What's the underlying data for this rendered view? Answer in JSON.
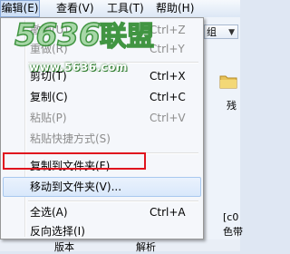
{
  "menubar": {
    "items": [
      {
        "label": "编辑(E)",
        "active": true
      },
      {
        "label": "查看(V)"
      },
      {
        "label": "工具(T)"
      },
      {
        "label": "帮助(H)"
      }
    ]
  },
  "background": {
    "combo_label": "组",
    "partial_text_1": "残",
    "partial_text_2": "[c0",
    "partial_text_3": "色带",
    "partial_text_4": "版本",
    "partial_text_5": "解析"
  },
  "menu": {
    "items": [
      {
        "label": "撤销(U)",
        "shortcut": "Ctrl+Z"
      },
      {
        "label": "重做(R)",
        "shortcut": "Ctrl+Y"
      },
      {
        "label": "剪切(T)",
        "shortcut": "Ctrl+X"
      },
      {
        "label": "复制(C)",
        "shortcut": "Ctrl+C"
      },
      {
        "label": "粘贴(P)",
        "shortcut": "Ctrl+V",
        "disabled": true
      },
      {
        "label": "粘贴快捷方式(S)",
        "disabled": true
      },
      {
        "label": "复制到文件夹(F)..."
      },
      {
        "label": "移动到文件夹(V)..."
      },
      {
        "label": "全选(A)",
        "shortcut": "Ctrl+A"
      },
      {
        "label": "反向选择(I)"
      }
    ]
  },
  "watermark": {
    "logo_text": "5636联盟",
    "url": "www.5636.com"
  },
  "colors": {
    "highlight_box": "#e0141e",
    "watermark_green": "#2e8b2e"
  }
}
